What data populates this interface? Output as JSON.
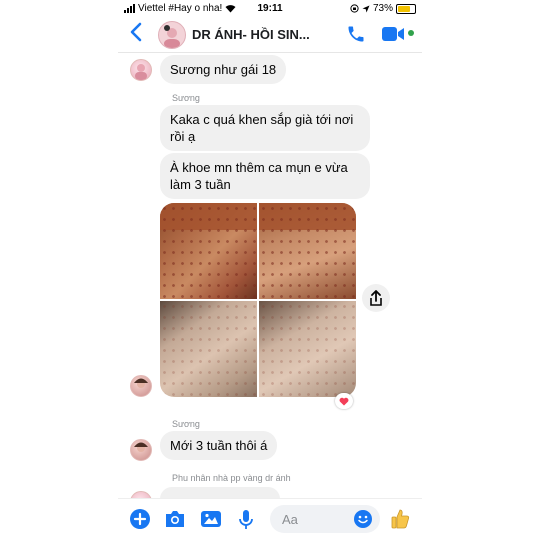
{
  "status_bar": {
    "carrier": "Viettel #Hay o nha!",
    "time": "19:11",
    "battery": "73%",
    "battery_level": 0.73
  },
  "header": {
    "title": "DR ÁNH- HỒI SIN...",
    "colors": {
      "accent": "#1877f2",
      "active": "#31a24c"
    }
  },
  "messages": [
    {
      "type": "text",
      "sender": "",
      "text": "Sương như gái 18"
    },
    {
      "type": "sender_label",
      "text": "Sương"
    },
    {
      "type": "text",
      "text": "Kaka c quá khen sắp già tới nơi rồi ạ"
    },
    {
      "type": "text",
      "text": "À khoe mn thêm ca mụn e vừa làm 3 tuần"
    },
    {
      "type": "photos",
      "count": 4,
      "reaction": "heart"
    },
    {
      "type": "sender_label",
      "text": "Sương"
    },
    {
      "type": "text",
      "text": "Mới 3 tuần thôi á"
    },
    {
      "type": "sender_label",
      "text": "Phu nhân nhà pp vàng dr ánh"
    }
  ],
  "composer": {
    "placeholder": "Aa",
    "icons": [
      "plus-icon",
      "camera-icon",
      "photo-icon",
      "microphone-icon",
      "emoji-icon",
      "thumbs-up-icon"
    ]
  }
}
